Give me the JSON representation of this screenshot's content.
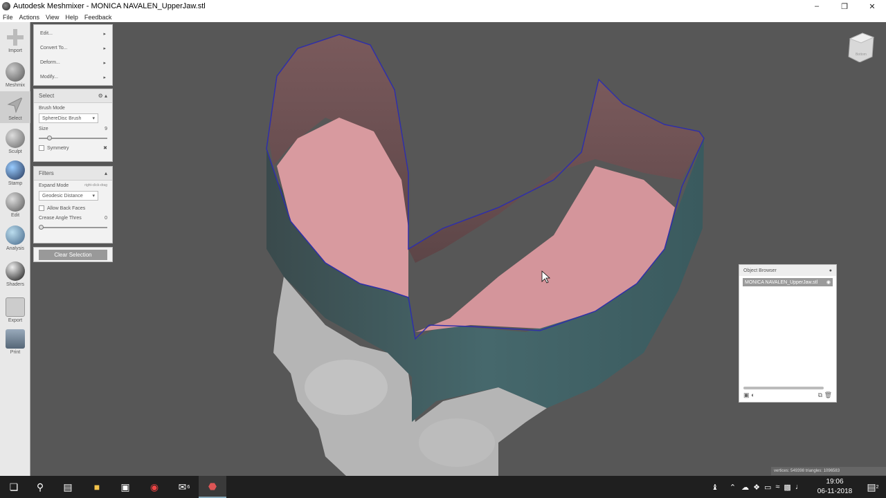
{
  "window": {
    "title": "Autodesk Meshmixer - MONICA NAVALEN_UpperJaw.stl",
    "minimize_icon": "minimize-icon",
    "maximize_icon": "restore-icon",
    "close_icon": "close-icon"
  },
  "menubar": [
    "File",
    "Actions",
    "View",
    "Help",
    "Feedback"
  ],
  "toolbar": [
    {
      "label": "Import",
      "icon": "plus-icon"
    },
    {
      "label": "Meshmix",
      "icon": "meshmix-icon"
    },
    {
      "label": "Select",
      "icon": "select-arrow-icon"
    },
    {
      "label": "Sculpt",
      "icon": "sculpt-brush-icon"
    },
    {
      "label": "Stamp",
      "icon": "stamp-icon"
    },
    {
      "label": "Edit",
      "icon": "edit-icon"
    },
    {
      "label": "Analysis",
      "icon": "analysis-icon"
    },
    {
      "label": "Shaders",
      "icon": "shaders-icon"
    },
    {
      "label": "Export",
      "icon": "export-icon"
    },
    {
      "label": "Print",
      "icon": "print-icon"
    }
  ],
  "actions_menu": [
    "Edit...",
    "Convert To...",
    "Deform...",
    "Modify..."
  ],
  "select_panel": {
    "title": "Select",
    "brush_mode_label": "Brush Mode",
    "brush_mode_value": "SphereDisc Brush",
    "size_label": "Size",
    "size_value": "9",
    "size_fraction": 0.13,
    "symmetry_label": "Symmetry"
  },
  "filters_panel": {
    "title": "Filters",
    "expand_mode_label": "Expand Mode",
    "expand_mode_hint": "right-click-drag",
    "expand_mode_value": "Geodesic Distance",
    "allow_back_faces_label": "Allow Back Faces",
    "crease_angle_label": "Crease Angle Thres",
    "crease_angle_value": "0",
    "crease_angle_fraction": 0.0
  },
  "clear_selection_label": "Clear Selection",
  "viewcube_label": "Bottom",
  "object_browser": {
    "title": "Object Browser",
    "items": [
      "MONICA NAVALEN_UpperJaw.stl"
    ]
  },
  "stats_text": "vertices: 549398 triangles: 1096583",
  "taskbar": {
    "time": "19:06",
    "date": "06-11-2018",
    "mail_badge": "6",
    "notification_count": "2"
  },
  "colors": {
    "viewport_bg": "#575757",
    "mesh_selected_outer": "#3f5f63",
    "mesh_inner_wall": "#6e5254",
    "mesh_inner_floor": "#d89a9f",
    "mesh_gray": "#b9b9b9",
    "boundary_line": "#2f2fa8"
  }
}
